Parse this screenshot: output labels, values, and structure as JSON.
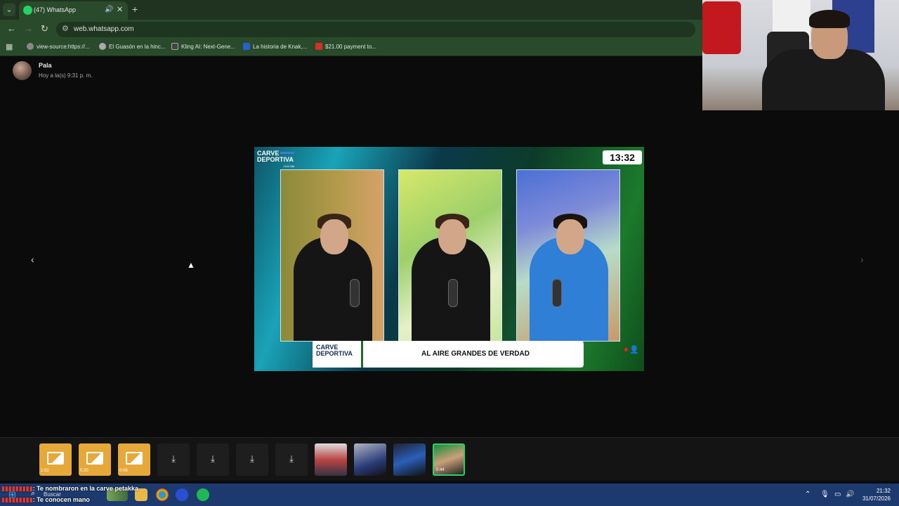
{
  "browser": {
    "tab_title": "(47) WhatsApp",
    "url": "web.whatsapp.com",
    "bookmarks": [
      {
        "label": "view-source:https://..."
      },
      {
        "label": "El Guasón en la hinc..."
      },
      {
        "label": "Kling AI: Next-Gene..."
      },
      {
        "label": "La historia de Knak,..."
      },
      {
        "label": "$21.00 payment to..."
      }
    ]
  },
  "sender": {
    "name": "Pala",
    "time": "Hoy a la(s) 9:31 p. m."
  },
  "video": {
    "brand_line1": "CARVE",
    "brand_line2": "DEPORTIVA",
    "brand_sub": "1010 AM",
    "timer": "13:32",
    "lower_third_title": "AL AIRE GRANDES DE VERDAD"
  },
  "thumbnails": [
    {
      "kind": "image",
      "duration": "1:02"
    },
    {
      "kind": "image",
      "duration": "0:20"
    },
    {
      "kind": "image",
      "duration": "0:06"
    },
    {
      "kind": "download"
    },
    {
      "kind": "download"
    },
    {
      "kind": "download"
    },
    {
      "kind": "download"
    },
    {
      "kind": "video"
    },
    {
      "kind": "video"
    },
    {
      "kind": "video"
    },
    {
      "kind": "video",
      "selected": true,
      "duration": "0:44"
    }
  ],
  "stream_chat": [
    {
      "text": ": Te nombraron en la carve petakka"
    },
    {
      "text": ": Te conocen mano"
    }
  ],
  "taskbar": {
    "search_placeholder": "Buscar",
    "time": "21:32",
    "date": "31/07/2026"
  },
  "colors": {
    "whatsapp_green": "#25d366",
    "chrome_theme": "#2a4a2c",
    "taskbar": "#1c3a6e"
  }
}
